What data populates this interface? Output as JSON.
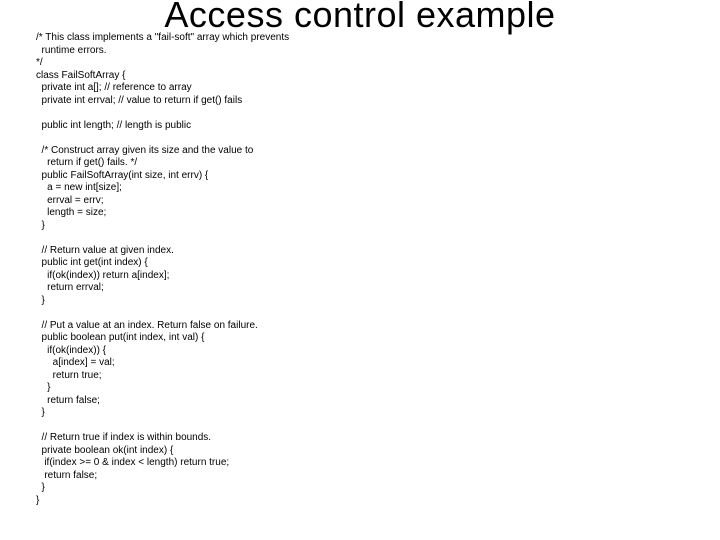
{
  "title": "Access control example",
  "code": "/* This class implements a \"fail-soft\" array which prevents\n  runtime errors.\n*/\nclass FailSoftArray {\n  private int a[]; // reference to array\n  private int errval; // value to return if get() fails\n\n  public int length; // length is public\n\n  /* Construct array given its size and the value to\n    return if get() fails. */\n  public FailSoftArray(int size, int errv) {\n    a = new int[size];\n    errval = errv;\n    length = size;\n  }\n\n  // Return value at given index.\n  public int get(int index) {\n    if(ok(index)) return a[index];\n    return errval;\n  }\n\n  // Put a value at an index. Return false on failure.\n  public boolean put(int index, int val) {\n    if(ok(index)) {\n      a[index] = val;\n      return true;\n    }\n    return false;\n  }\n\n  // Return true if index is within bounds.\n  private boolean ok(int index) {\n   if(index >= 0 & index < length) return true;\n   return false;\n  }\n}"
}
